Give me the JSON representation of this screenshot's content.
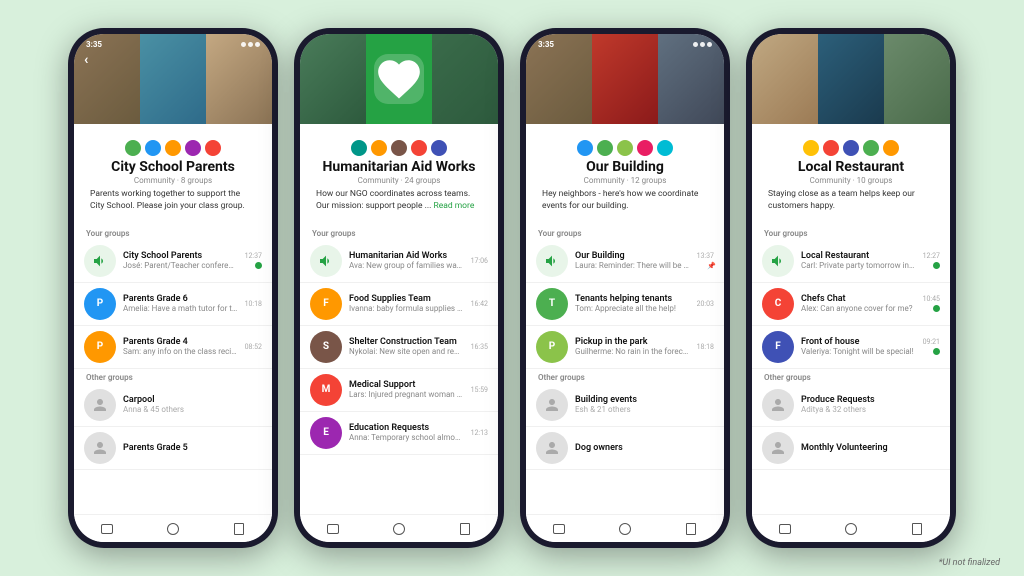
{
  "disclaimer": "*UI not finalized",
  "phones": [
    {
      "id": "phone1",
      "statusTime": "3:35",
      "title": "City School Parents",
      "meta": "Community · 8 groups",
      "desc": "Parents working together to support the City School. Please join your class group.",
      "yourGroupsLabel": "Your groups",
      "yourGroups": [
        {
          "name": "City School Parents",
          "preview": "José: Parent/Teacher conferences ...",
          "time": "12:37",
          "hasUnread": true,
          "hasPin": false,
          "avatarColor": "av-green"
        },
        {
          "name": "Parents Grade 6",
          "preview": "Amelia: Have a math tutor for the upco...",
          "time": "10:18",
          "hasUnread": false,
          "hasPin": false,
          "avatarColor": "av-blue"
        },
        {
          "name": "Parents Grade 4",
          "preview": "Sam: any info on the class recital?",
          "time": "08:52",
          "hasUnread": false,
          "hasPin": false,
          "avatarColor": "av-orange"
        }
      ],
      "otherGroupsLabel": "Other groups",
      "otherGroups": [
        {
          "name": "Carpool",
          "sub": "Anna & 45 others"
        },
        {
          "name": "Parents Grade 5",
          "sub": ""
        }
      ]
    },
    {
      "id": "phone2",
      "statusTime": "",
      "title": "Humanitarian Aid Works",
      "meta": "Community · 24 groups",
      "desc": "How our NGO coordinates across teams. Our mission: support people ...",
      "readMore": "Read more",
      "yourGroupsLabel": "Your groups",
      "yourGroups": [
        {
          "name": "Humanitarian Aid Works",
          "preview": "Ava: New group of families waiting ...",
          "time": "17:06",
          "hasUnread": false,
          "hasPin": false,
          "avatarColor": "av-teal"
        },
        {
          "name": "Food Supplies Team",
          "preview": "Ivanna: baby formula supplies running ...",
          "time": "16:42",
          "hasUnread": false,
          "hasPin": false,
          "avatarColor": "av-orange"
        },
        {
          "name": "Shelter Construction Team",
          "preview": "Nykolai: New site open and ready for ...",
          "time": "16:35",
          "hasUnread": false,
          "hasPin": false,
          "avatarColor": "av-brown"
        },
        {
          "name": "Medical Support",
          "preview": "Lars: Injured pregnant woman in need ...",
          "time": "15:59",
          "hasUnread": false,
          "hasPin": false,
          "avatarColor": "av-red"
        },
        {
          "name": "Education Requests",
          "preview": "Anna: Temporary school almost comp...",
          "time": "12:13",
          "hasUnread": false,
          "hasPin": false,
          "avatarColor": "av-purple"
        }
      ],
      "otherGroupsLabel": "",
      "otherGroups": []
    },
    {
      "id": "phone3",
      "statusTime": "3:35",
      "title": "Our Building",
      "meta": "Community · 12 groups",
      "desc": "Hey neighbors - here's how we coordinate events for our building.",
      "yourGroupsLabel": "Your groups",
      "yourGroups": [
        {
          "name": "Our Building",
          "preview": "Laura: Reminder: There will be ...",
          "time": "13:37",
          "hasUnread": false,
          "hasPin": true,
          "avatarColor": "av-blue"
        },
        {
          "name": "Tenants helping tenants",
          "preview": "Tom: Appreciate all the help!",
          "time": "20:03",
          "hasUnread": false,
          "hasPin": false,
          "avatarColor": "av-green"
        },
        {
          "name": "Pickup in the park",
          "preview": "Guilherme: No rain in the forecast!",
          "time": "18:18",
          "hasUnread": false,
          "hasPin": false,
          "avatarColor": "av-lime"
        }
      ],
      "otherGroupsLabel": "Other groups",
      "otherGroups": [
        {
          "name": "Building events",
          "sub": "Esh & 21 others"
        },
        {
          "name": "Dog owners",
          "sub": ""
        }
      ]
    },
    {
      "id": "phone4",
      "statusTime": "",
      "title": "Local Restaurant",
      "meta": "Community · 10 groups",
      "desc": "Staying close as a team helps keep our customers happy.",
      "yourGroupsLabel": "Your groups",
      "yourGroups": [
        {
          "name": "Local Restaurant",
          "preview": "Carl: Private party tomorrow in the ...",
          "time": "12:27",
          "hasUnread": true,
          "hasPin": false,
          "avatarColor": "av-amber"
        },
        {
          "name": "Chefs Chat",
          "preview": "Alex: Can anyone cover for me?",
          "time": "10:45",
          "hasUnread": true,
          "hasPin": false,
          "avatarColor": "av-red"
        },
        {
          "name": "Front of house",
          "preview": "Valeriya: Tonight will be special!",
          "time": "09:21",
          "hasUnread": true,
          "hasPin": false,
          "avatarColor": "av-indigo"
        }
      ],
      "otherGroupsLabel": "Other groups",
      "otherGroups": [
        {
          "name": "Produce Requests",
          "sub": "Aditya & 32 others"
        },
        {
          "name": "Monthly Volunteering",
          "sub": ""
        }
      ]
    }
  ]
}
